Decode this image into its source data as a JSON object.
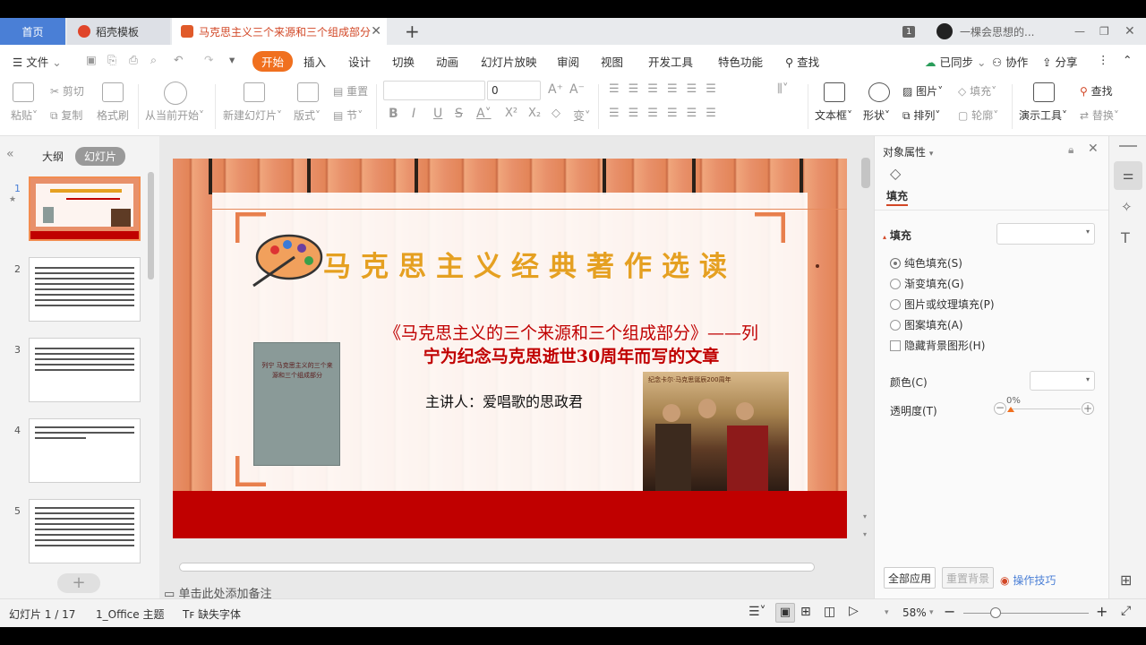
{
  "tabs": {
    "home": "首页",
    "template": "稻壳模板",
    "document": "马克思主义三个来源和三个组成部分"
  },
  "titlebar_right": {
    "badge": "1",
    "user": "一棵会思想的..."
  },
  "menu": {
    "file": "文件",
    "items": [
      "开始",
      "插入",
      "设计",
      "切换",
      "动画",
      "幻灯片放映",
      "审阅",
      "视图",
      "开发工具",
      "特色功能"
    ],
    "search": "查找",
    "synced": "已同步",
    "collab": "协作",
    "share": "分享"
  },
  "ribbon": {
    "paste": "粘贴",
    "cut": "剪切",
    "copy": "复制",
    "format_painter": "格式刷",
    "from_current": "从当前开始",
    "new_slide": "新建幻灯片",
    "layout": "版式",
    "reset": "重置",
    "section": "节",
    "font_size": "0",
    "text_box": "文本框",
    "shape": "形状",
    "picture": "图片",
    "fill": "填充",
    "arrange": "排列",
    "outline": "轮廓",
    "present_tools": "演示工具",
    "find": "查找",
    "replace": "替换",
    "bold": "B",
    "italic": "I",
    "underline": "U",
    "strike": "S",
    "font_color": "A"
  },
  "left_pane": {
    "outline_tab": "大纲",
    "slides_tab": "幻灯片",
    "slide_numbers": [
      "1",
      "2",
      "3",
      "4",
      "5"
    ]
  },
  "slide": {
    "title": "马克思主义经典著作选读",
    "subtitle_line1": "《马克思主义的三个来源和三个组成部分》——列",
    "subtitle_line2": "宁为纪念马克思逝世30周年而写的文章",
    "speaker": "主讲人：爱唱歌的思政君",
    "book_text": "列宁 马克思主义的三个来源和三个组成部分",
    "poster_caption": "纪念卡尔·马克思诞辰200周年"
  },
  "notes": {
    "placeholder": "单击此处添加备注"
  },
  "right_pane": {
    "title": "对象属性",
    "tab_fill": "填充",
    "section_fill": "填充",
    "solid": "纯色填充(S)",
    "gradient": "渐变填充(G)",
    "picture_texture": "图片或纹理填充(P)",
    "pattern": "图案填充(A)",
    "hide_bg": "隐藏背景图形(H)",
    "color_label": "颜色(C)",
    "transparency_label": "透明度(T)",
    "transparency_value": "0%",
    "apply_all": "全部应用",
    "reset_bg": "重置背景",
    "tips": "操作技巧"
  },
  "status": {
    "slide_pos": "幻灯片 1 / 17",
    "theme": "1_Office 主题",
    "missing_font": "缺失字体",
    "zoom": "58%"
  },
  "colors": {
    "accent": "#f0701f",
    "tab_active_text": "#d24726",
    "title_gold": "#e5a021",
    "slide_red": "#c00000",
    "link_blue": "#4a7fd6"
  }
}
